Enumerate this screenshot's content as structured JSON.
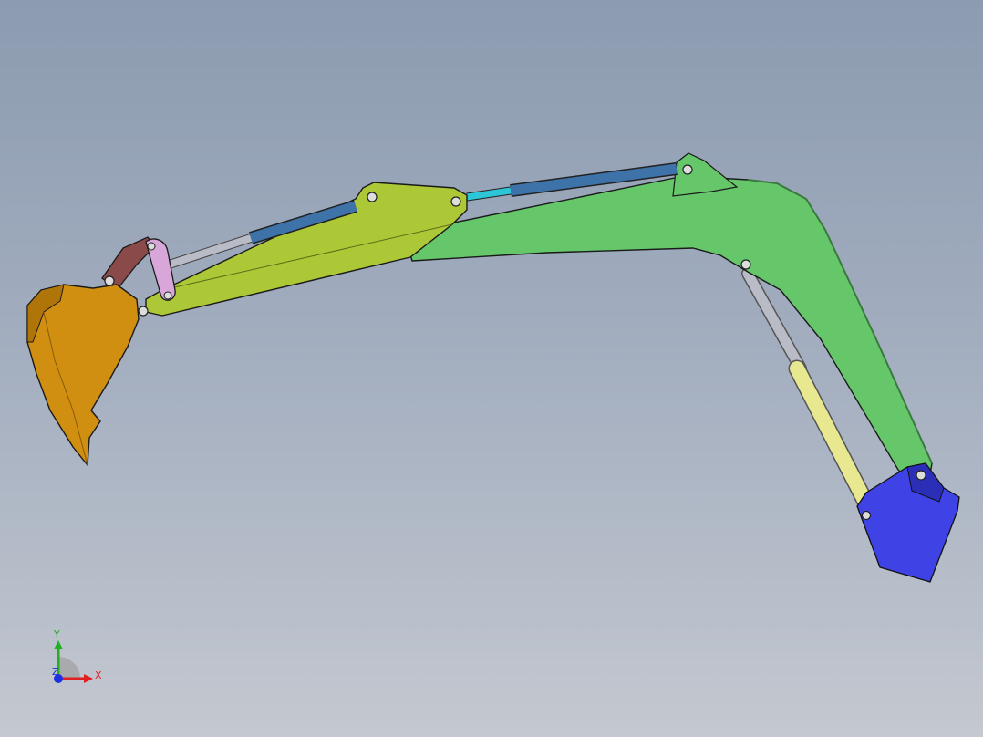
{
  "viewport": {
    "background_top": "#8c9bb0",
    "background_bottom": "#c4c8d0"
  },
  "model": {
    "parts": [
      {
        "name": "bucket",
        "color": "#d18f12"
      },
      {
        "name": "bucket-link",
        "color": "#8b4a4a"
      },
      {
        "name": "rocker-link",
        "color": "#d8a6d8"
      },
      {
        "name": "stick-arm",
        "color": "#adc836"
      },
      {
        "name": "boom",
        "color": "#66c66a"
      },
      {
        "name": "swing-base",
        "color": "#3f43e6"
      },
      {
        "name": "bucket-cylinder-barrel",
        "color": "#3d73a8"
      },
      {
        "name": "bucket-cylinder-rod",
        "color": "#b9bcc6"
      },
      {
        "name": "stick-cylinder-barrel",
        "color": "#3d73a8"
      },
      {
        "name": "stick-cylinder-rod",
        "color": "#2cc6d6"
      },
      {
        "name": "boom-cylinder-barrel",
        "color": "#e8e890"
      },
      {
        "name": "boom-cylinder-rod",
        "color": "#b9bcc6"
      }
    ]
  },
  "triad": {
    "x_label": "X",
    "y_label": "Y",
    "z_label": "Z",
    "x_color": "#e02020",
    "y_color": "#20b020",
    "z_color": "#2030e0"
  }
}
